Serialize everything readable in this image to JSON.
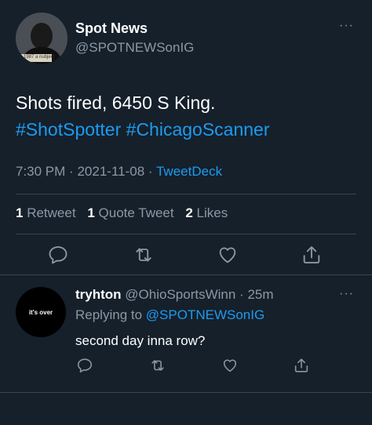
{
  "tweet": {
    "author_name": "Spot News",
    "author_handle": "@SPOTNEWSonIG",
    "avatar_caption": "1987 a nubject",
    "text_line1": "Shots fired, 6450 S King.",
    "hashtag1": "#ShotSpotter",
    "hashtag2": "#ChicagoScanner",
    "time": "7:30 PM",
    "date": "2021-11-08",
    "source": "TweetDeck",
    "sep": "·",
    "stats": {
      "retweets_count": "1",
      "retweets_label": "Retweet",
      "quotes_count": "1",
      "quotes_label": "Quote Tweet",
      "likes_count": "2",
      "likes_label": "Likes"
    },
    "more": "···"
  },
  "reply": {
    "avatar_text": "it's over",
    "author_name": "tryhton",
    "author_handle": "@OhioSportsWinn",
    "sep": "·",
    "age": "25m",
    "replying_prefix": "Replying to",
    "replying_to": "@SPOTNEWSonIG",
    "text": "second day inna row?",
    "more": "···"
  },
  "icons": {
    "reply": "reply-icon",
    "retweet": "retweet-icon",
    "like": "heart-icon",
    "share": "share-icon"
  },
  "colors": {
    "background": "#15202b",
    "link": "#1d9bf0",
    "muted": "#8b98a5",
    "divider": "#38444d"
  }
}
